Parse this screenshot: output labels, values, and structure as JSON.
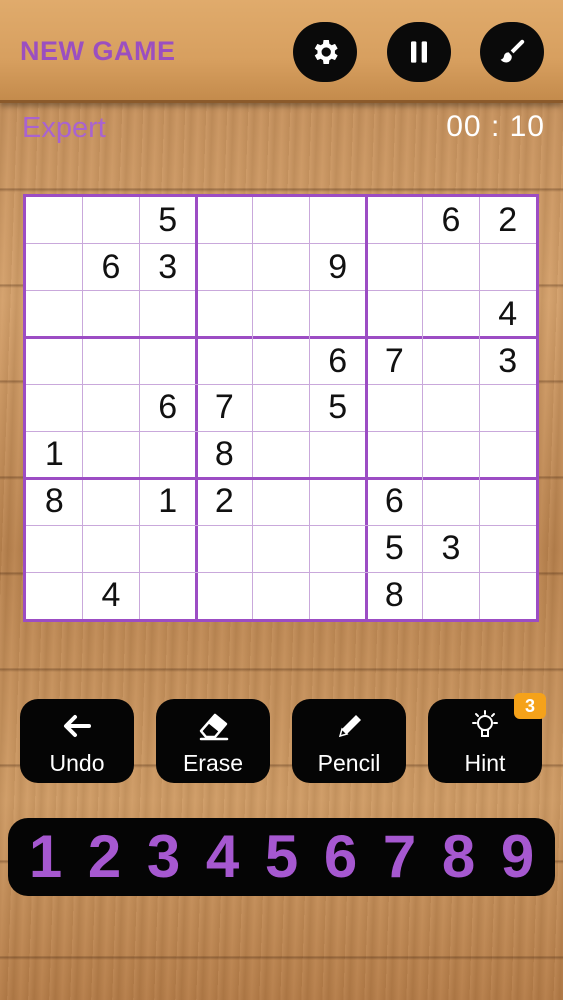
{
  "header": {
    "new_game_label": "NEW GAME",
    "settings_icon": "gear-icon",
    "pause_icon": "pause-icon",
    "theme_icon": "paintbrush-icon"
  },
  "game": {
    "difficulty": "Expert",
    "timer": "00 : 10"
  },
  "board": {
    "rows": [
      [
        "",
        "",
        "5",
        "",
        "",
        "",
        "",
        "6",
        "2"
      ],
      [
        "",
        "6",
        "3",
        "",
        "",
        "9",
        "",
        "",
        ""
      ],
      [
        "",
        "",
        "",
        "",
        "",
        "",
        "",
        "",
        "4"
      ],
      [
        "",
        "",
        "",
        "",
        "",
        "6",
        "7",
        "",
        "3"
      ],
      [
        "",
        "",
        "6",
        "7",
        "",
        "5",
        "",
        "",
        ""
      ],
      [
        "1",
        "",
        "",
        "8",
        "",
        "",
        "",
        "",
        ""
      ],
      [
        "8",
        "",
        "1",
        "2",
        "",
        "",
        "6",
        "",
        ""
      ],
      [
        "",
        "",
        "",
        "",
        "",
        "",
        "5",
        "3",
        ""
      ],
      [
        "",
        "4",
        "",
        "",
        "",
        "",
        "8",
        "",
        ""
      ]
    ]
  },
  "tools": {
    "undo_label": "Undo",
    "erase_label": "Erase",
    "pencil_label": "Pencil",
    "hint_label": "Hint",
    "hint_count": "3"
  },
  "numpad": [
    "1",
    "2",
    "3",
    "4",
    "5",
    "6",
    "7",
    "8",
    "9"
  ],
  "colors": {
    "accent": "#9c4dc4",
    "badge": "#f5a21a",
    "wood": "#c99058"
  }
}
